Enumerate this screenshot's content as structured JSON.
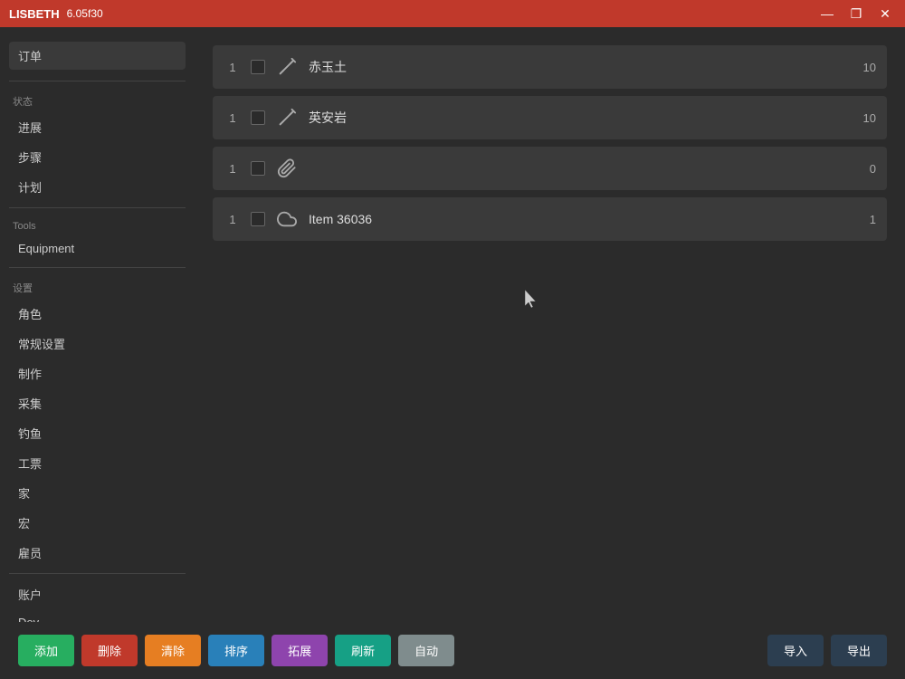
{
  "titlebar": {
    "app_name": "LISBETH",
    "version": "6.05f30",
    "minimize_label": "—",
    "restore_label": "❐",
    "close_label": "✕"
  },
  "sidebar": {
    "order_label": "订单",
    "section_status": "状态",
    "items_status": [
      {
        "label": "进展"
      },
      {
        "label": "步骤"
      },
      {
        "label": "计划"
      }
    ],
    "section_tools": "Tools",
    "items_tools": [
      {
        "label": "Equipment"
      }
    ],
    "section_settings": "设置",
    "items_settings": [
      {
        "label": "角色"
      },
      {
        "label": "常规设置"
      },
      {
        "label": "制作"
      },
      {
        "label": "采集"
      },
      {
        "label": "钓鱼"
      },
      {
        "label": "工票"
      },
      {
        "label": "家"
      },
      {
        "label": "宏"
      },
      {
        "label": "雇员"
      }
    ],
    "items_account": [
      {
        "label": "账户"
      },
      {
        "label": "Dev"
      }
    ]
  },
  "items": [
    {
      "qty": 1,
      "name": "赤玉土",
      "count": 10,
      "icon_type": "pickaxe"
    },
    {
      "qty": 1,
      "name": "英安岩",
      "count": 10,
      "icon_type": "pickaxe"
    },
    {
      "qty": 1,
      "name": "",
      "count": 0,
      "icon_type": "paperclip"
    },
    {
      "qty": 1,
      "name": "Item 36036",
      "count": 1,
      "icon_type": "cloud"
    }
  ],
  "toolbar": {
    "add_label": "添加",
    "delete_label": "删除",
    "clear_label": "清除",
    "sort_label": "排序",
    "expand_label": "拓展",
    "refresh_label": "刷新",
    "auto_label": "自动",
    "import_label": "导入",
    "export_label": "导出"
  }
}
